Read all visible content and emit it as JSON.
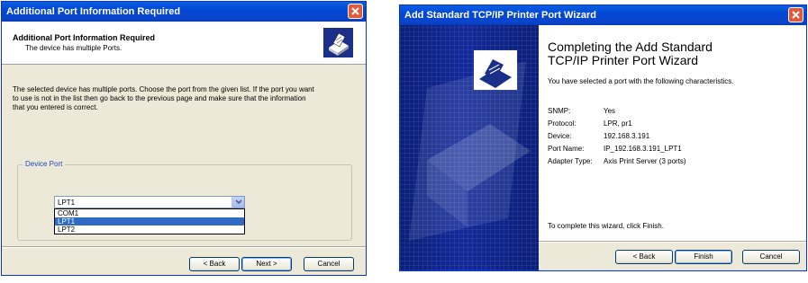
{
  "left_dialog": {
    "title": "Additional Port Information Required",
    "header_title": "Additional Port Information Required",
    "header_subtitle": "The device has multiple Ports.",
    "body_line1": "The selected device has multiple ports.  Choose the port from the given list.  If the port you want",
    "body_line2": "to use is not in the list then go back to the previous page and make sure that the information",
    "body_line3": "that you entered is correct.",
    "group_label": "Device Port",
    "combo_value": "LPT1",
    "options": [
      "COM1",
      "LPT1",
      "LPT2"
    ],
    "selected_index": 1,
    "buttons": {
      "back": "< Back",
      "next": "Next >",
      "cancel": "Cancel"
    }
  },
  "right_dialog": {
    "title": "Add Standard TCP/IP Printer Port Wizard",
    "heading_line1": "Completing the Add Standard",
    "heading_line2": "TCP/IP Printer Port Wizard",
    "intro": "You have selected a port with the following characteristics.",
    "fields": [
      {
        "key": "SNMP:",
        "value": "Yes"
      },
      {
        "key": "Protocol:",
        "value": "LPR, pr1"
      },
      {
        "key": "Device:",
        "value": "192.168.3.191"
      },
      {
        "key": "Port Name:",
        "value": "IP_192.168.3.191_LPT1"
      },
      {
        "key": "Adapter Type:",
        "value": "Axis Print Server (3 ports)"
      }
    ],
    "finish_hint": "To complete this wizard, click Finish.",
    "buttons": {
      "back": "< Back",
      "finish": "Finish",
      "cancel": "Cancel"
    }
  },
  "icons": [
    "close-icon",
    "printer-icon",
    "chevron-down-icon",
    "printer-wizard-graphic"
  ],
  "colors": {
    "titlebar": "#0348d6",
    "selection": "#316ac5",
    "dialog_face": "#ece9d8",
    "wizard_banner": "#12299a",
    "group_label": "#1c49c2"
  }
}
